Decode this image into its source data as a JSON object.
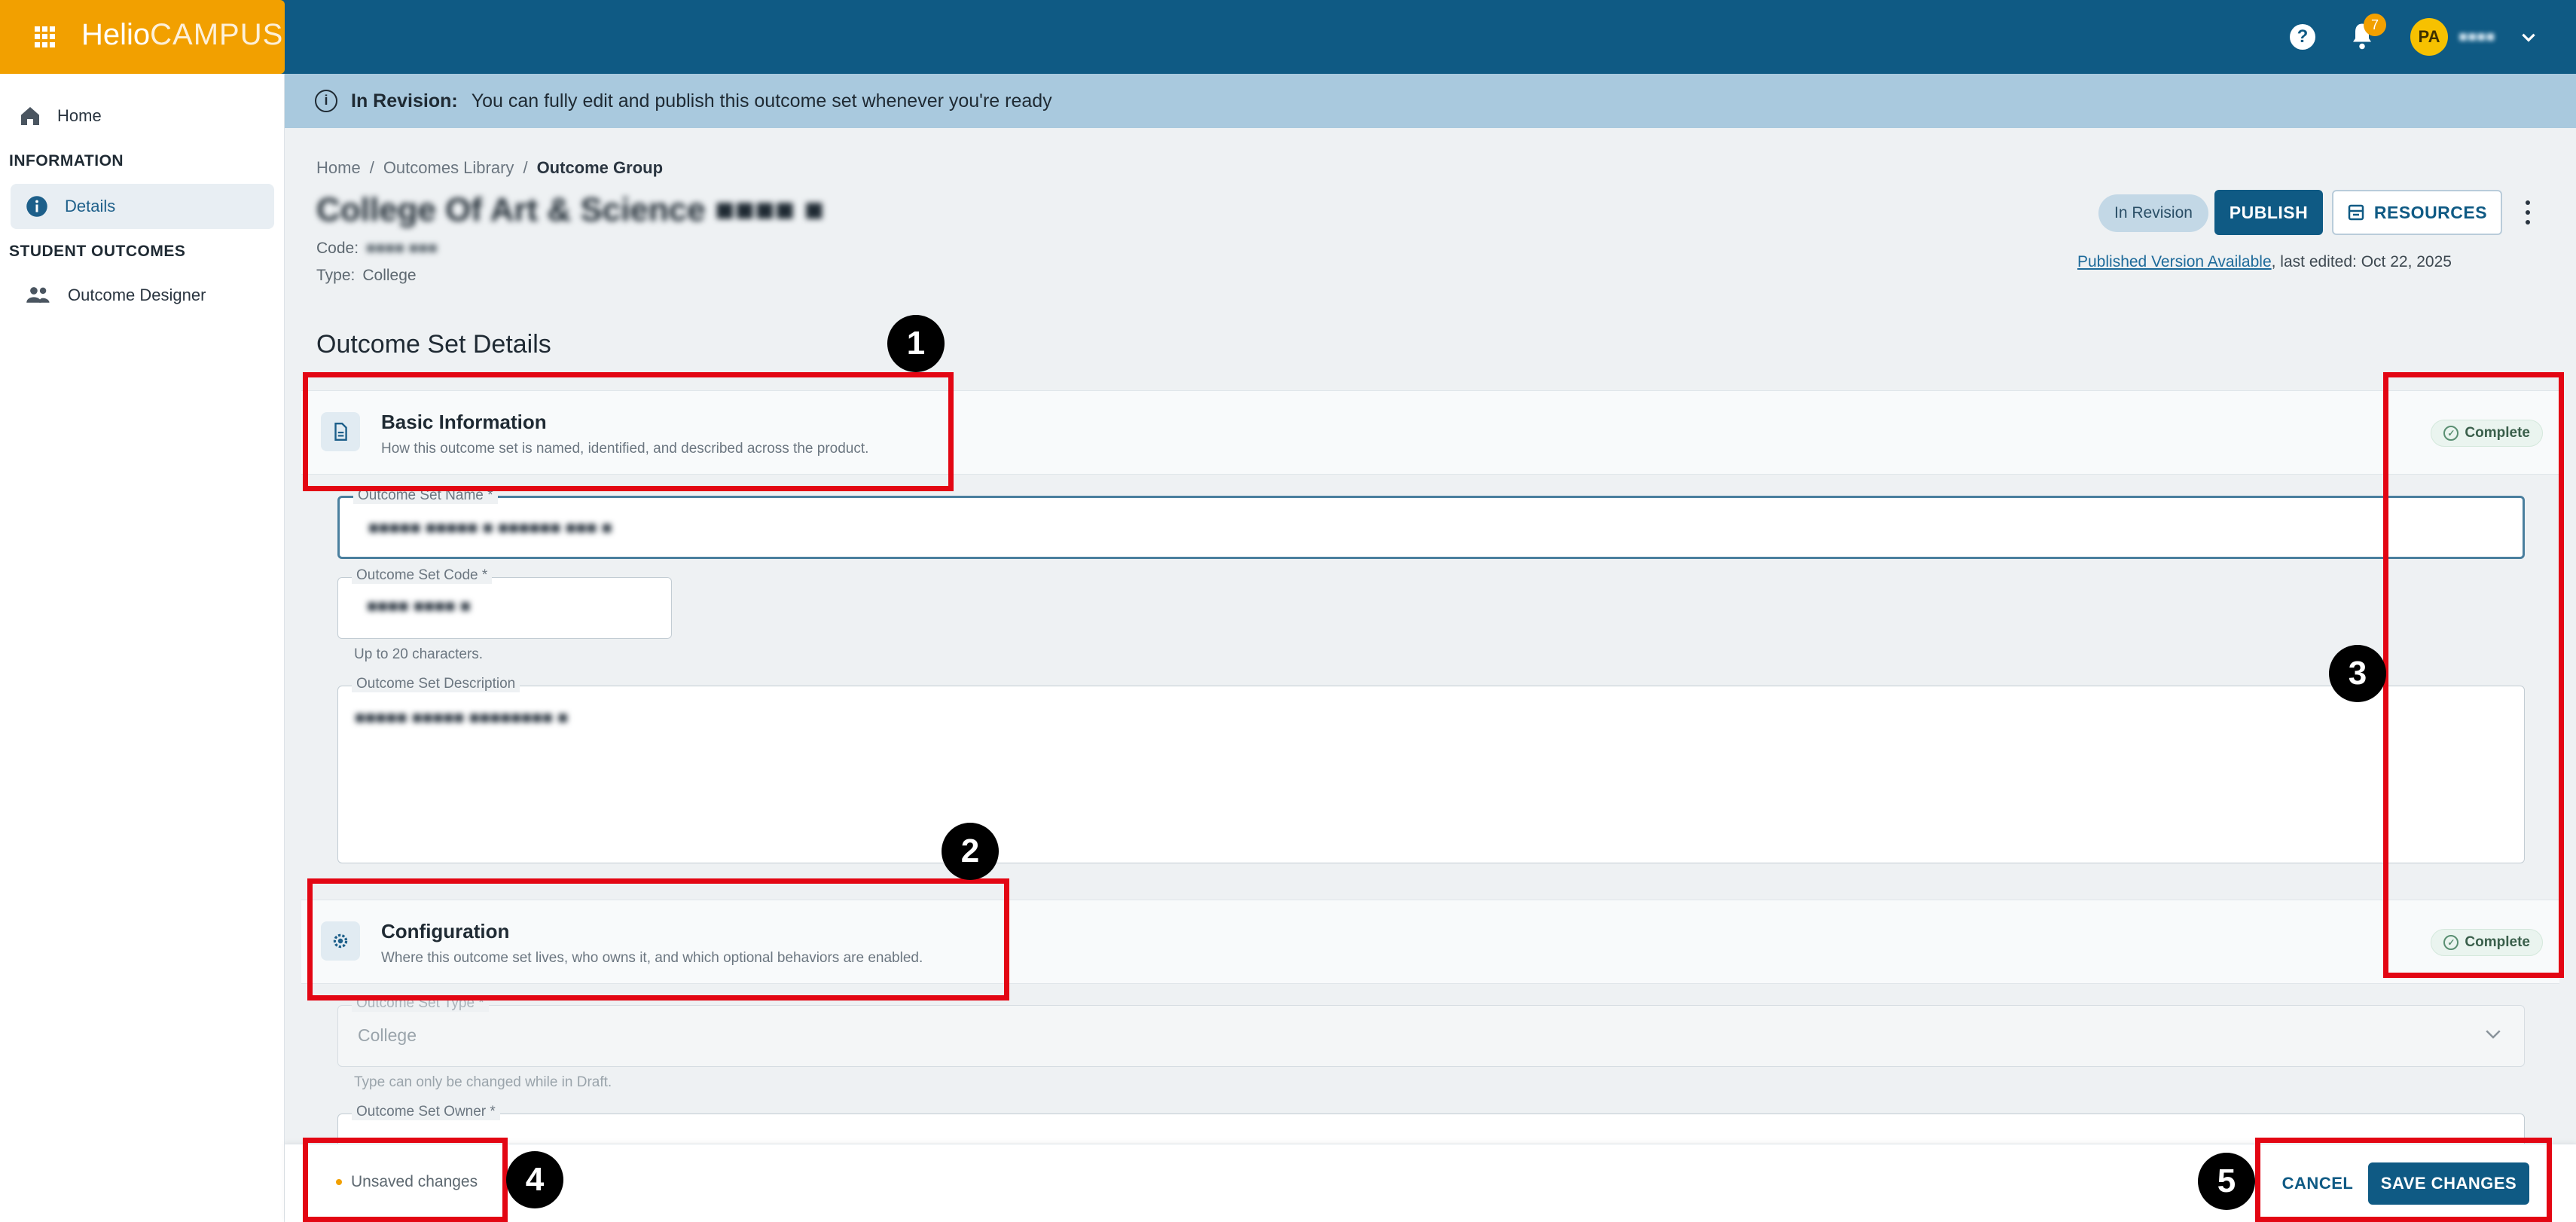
{
  "app": {
    "brand_main": "Helio",
    "brand_sub": "CAMPUS",
    "notification_count": "7",
    "user_initials": "PA",
    "user_name": "■■■■"
  },
  "sidebar": {
    "home_label": "Home",
    "section_information": "INFORMATION",
    "details_label": "Details",
    "section_student_outcomes": "STUDENT OUTCOMES",
    "outcome_designer_label": "Outcome Designer"
  },
  "banner": {
    "title": "In Revision:",
    "message": "You can fully edit and publish this outcome set whenever you're ready"
  },
  "breadcrumb": [
    "Home",
    "Outcomes Library",
    "Outcome Group"
  ],
  "header": {
    "title": "College Of Art & Science ■■■■ ■",
    "code_label": "Code:",
    "code_value": "■■■■ ■■■",
    "type_label": "Type:",
    "type_value": "College",
    "status": "In Revision",
    "publish_label": "PUBLISH",
    "resources_label": "RESOURCES",
    "published_link": "Published Version Available",
    "last_edited": ", last edited: Oct 22, 2025"
  },
  "section_heading": "Outcome Set Details",
  "basic_info": {
    "title": "Basic Information",
    "subtitle": "How this outcome set is named, identified, and described across the product.",
    "status": "Complete",
    "name_label": "Outcome Set Name *",
    "name_value": "■■■■■ ■■■■■ ■ ■■■■■■ ■■■ ■",
    "code_label": "Outcome Set Code *",
    "code_value": "■■■■ ■■■■ ■",
    "code_helper": "Up to 20 characters.",
    "desc_label": "Outcome Set Description",
    "desc_value": "■■■■■ ■■■■■ ■■■■■■■■ ■"
  },
  "configuration": {
    "title": "Configuration",
    "subtitle": "Where this outcome set lives, who owns it, and which optional behaviors are enabled.",
    "status": "Complete",
    "type_label": "Outcome Set Type *",
    "type_value": "College",
    "type_helper": "Type can only be changed while in Draft.",
    "owner_label": "Outcome Set Owner *"
  },
  "footer": {
    "unsaved": "Unsaved changes",
    "cancel_label": "CANCEL",
    "save_label": "SAVE CHANGES"
  },
  "callouts": [
    "1",
    "2",
    "3",
    "4",
    "5"
  ],
  "colors": {
    "brand": "#f2a000",
    "primary": "#0f5a84",
    "callout": "#e30613"
  }
}
